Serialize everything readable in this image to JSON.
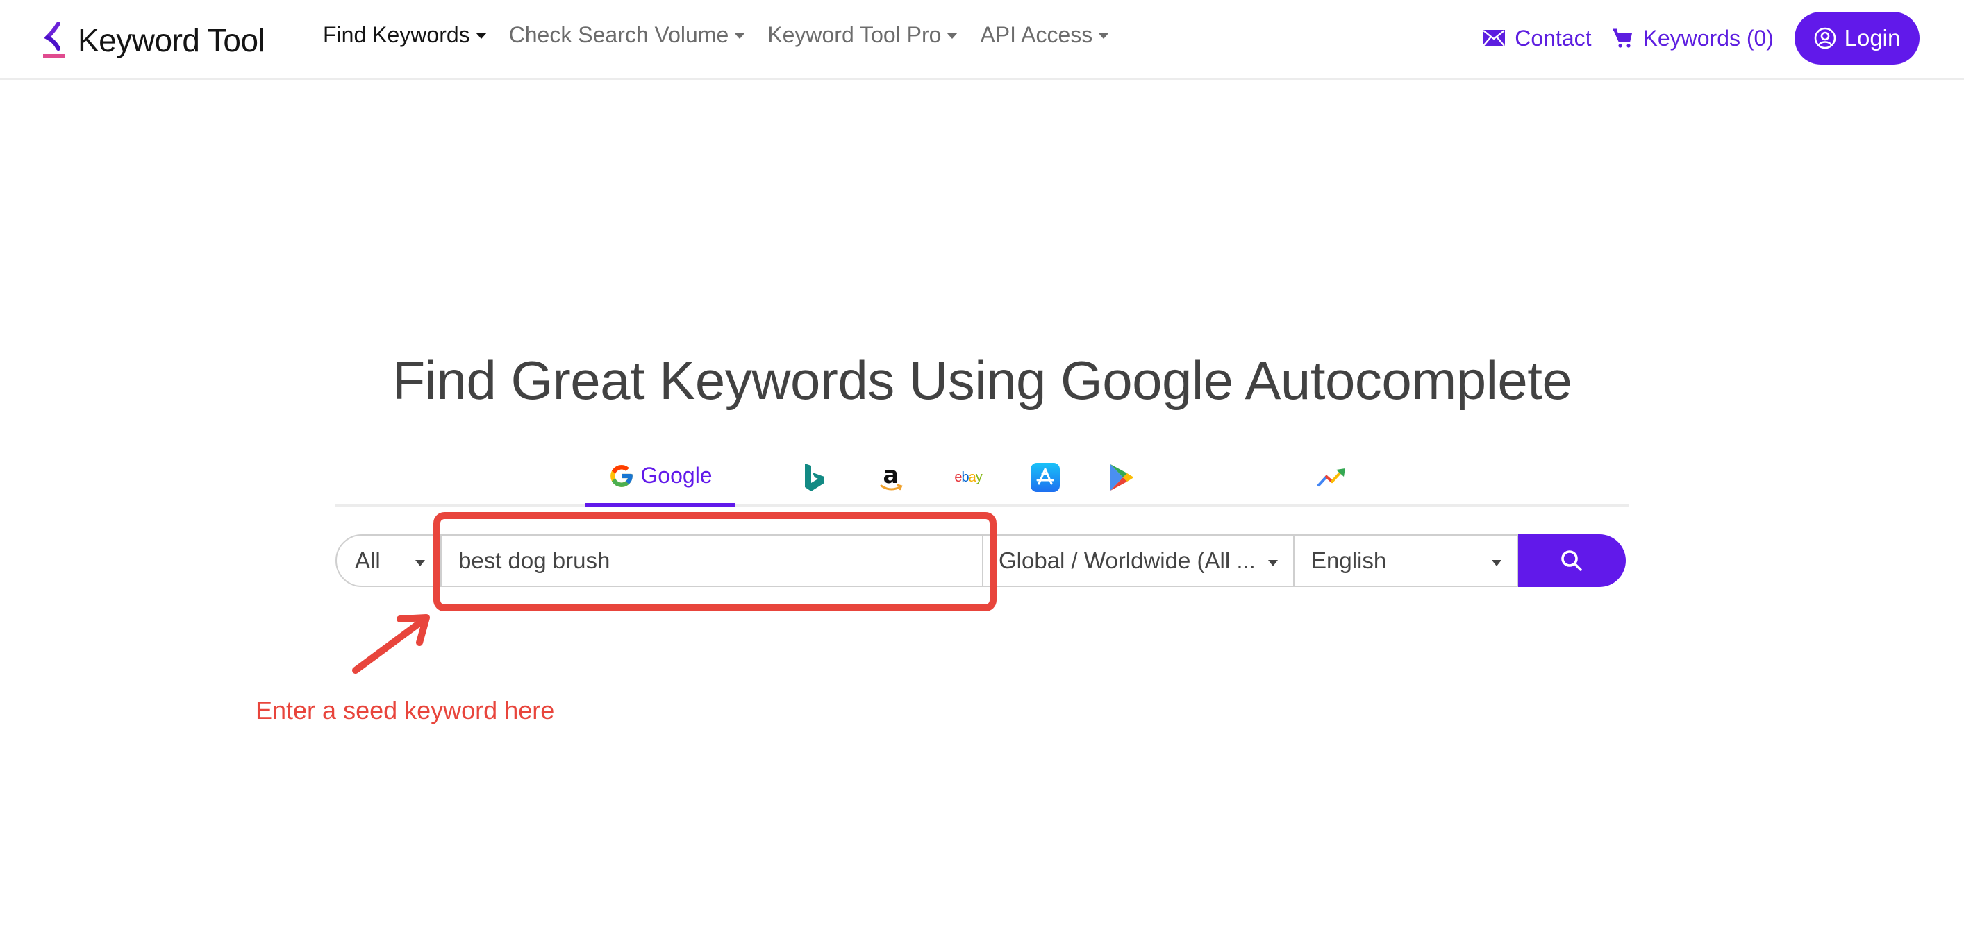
{
  "navbar": {
    "brand": {
      "name": "Keyword Tool",
      "icon": "keyword-tool-logo-icon"
    },
    "links": [
      {
        "label": "Find Keywords",
        "active": true,
        "dropdown": true
      },
      {
        "label": "Check Search Volume",
        "active": false,
        "dropdown": true
      },
      {
        "label": "Keyword Tool Pro",
        "active": false,
        "dropdown": true
      },
      {
        "label": "API Access",
        "active": false,
        "dropdown": true
      }
    ],
    "contact": {
      "label": "Contact",
      "icon": "envelope-icon"
    },
    "cart": {
      "label": "Keywords (0)",
      "icon": "cart-icon"
    },
    "login": {
      "label": "Login",
      "icon": "user-circle-icon"
    }
  },
  "hero": {
    "title": "Find Great Keywords Using Google Autocomplete"
  },
  "source_tabs": [
    {
      "id": "google",
      "label": "Google",
      "icon": "google-icon",
      "active": true
    },
    {
      "id": "bing",
      "label": "",
      "icon": "bing-icon",
      "active": false
    },
    {
      "id": "amazon",
      "label": "",
      "icon": "amazon-icon",
      "active": false
    },
    {
      "id": "ebay",
      "label": "",
      "icon": "ebay-icon",
      "active": false
    },
    {
      "id": "app-store",
      "label": "",
      "icon": "app-store-icon",
      "active": false
    },
    {
      "id": "play-store",
      "label": "",
      "icon": "play-store-icon",
      "active": false
    },
    {
      "id": "trends",
      "label": "",
      "icon": "trends-icon",
      "active": false
    }
  ],
  "ebay_text": {
    "e": "e",
    "b": "b",
    "a": "a",
    "y": "y"
  },
  "search": {
    "type_select": "All",
    "keyword_value": "best dog brush",
    "country_select": "Global / Worldwide (All ...",
    "language_select": "English",
    "submit_icon": "search-icon"
  },
  "annotation": {
    "text": "Enter a seed keyword here",
    "color": "#e8453c"
  },
  "colors": {
    "brand_purple": "#6119ea",
    "annotation_red": "#e8453c",
    "heading": "#424242"
  }
}
